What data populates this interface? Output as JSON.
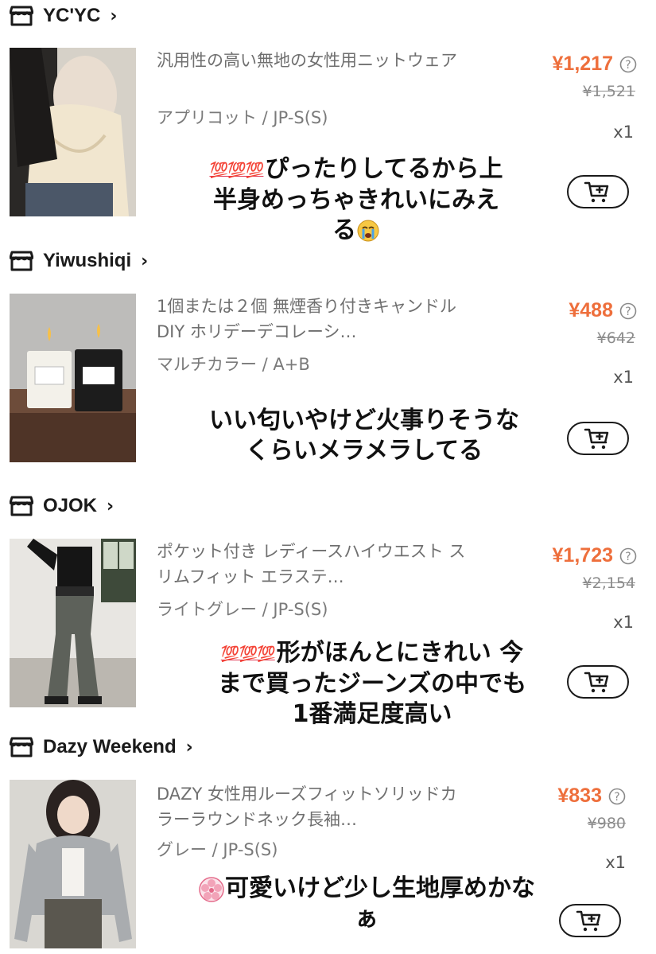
{
  "stores": [
    {
      "name": "YC'YC",
      "chevron": "›",
      "product": {
        "title": "汎用性の高い無地の女性用ニットウェア",
        "variant": "アプリコット / JP-S(S)",
        "price": "¥1,217",
        "original_price": "¥1,521",
        "quantity": "x1",
        "comment_emoji": "💯💯💯",
        "comment": "ぴったりしてるから上半身めっちゃきれいにみえる",
        "comment_tail_emoji": "😭"
      }
    },
    {
      "name": "Yiwushiqi",
      "chevron": "›",
      "product": {
        "title": "1個または２個 無煙香り付きキャンドル DIY ホリデーデコレーシ…",
        "variant": "マルチカラー / A+B",
        "price": "¥488",
        "original_price": "¥642",
        "quantity": "x1",
        "comment": "いい匂いやけど火事りそうなくらいメラメラしてる"
      }
    },
    {
      "name": "OJOK",
      "chevron": "›",
      "product": {
        "title": "ポケット付き レディースハイウエスト スリムフィット エラステ…",
        "variant": "ライトグレー / JP-S(S)",
        "price": "¥1,723",
        "original_price": "¥2,154",
        "quantity": "x1",
        "comment_emoji": "💯💯💯",
        "comment": "形がほんとにきれい 今まで買ったジーンズの中でも1番満足度高い"
      }
    },
    {
      "name": "Dazy Weekend",
      "chevron": "›",
      "product": {
        "title": "DAZY 女性用ルーズフィットソリッドカラーラウンドネック長袖…",
        "variant": "グレー / JP-S(S)",
        "price": "¥833",
        "original_price": "¥980",
        "quantity": "x1",
        "comment_emoji": "🌸",
        "comment": "可愛いけど少し生地厚めかなぁ"
      }
    }
  ],
  "icons": {
    "store": "store-icon",
    "help": "question-circle-icon",
    "cart": "add-to-cart-icon"
  },
  "colors": {
    "price": "#ee6f3c",
    "text_primary": "#1a1a1a",
    "text_secondary": "#7a7a7a"
  }
}
